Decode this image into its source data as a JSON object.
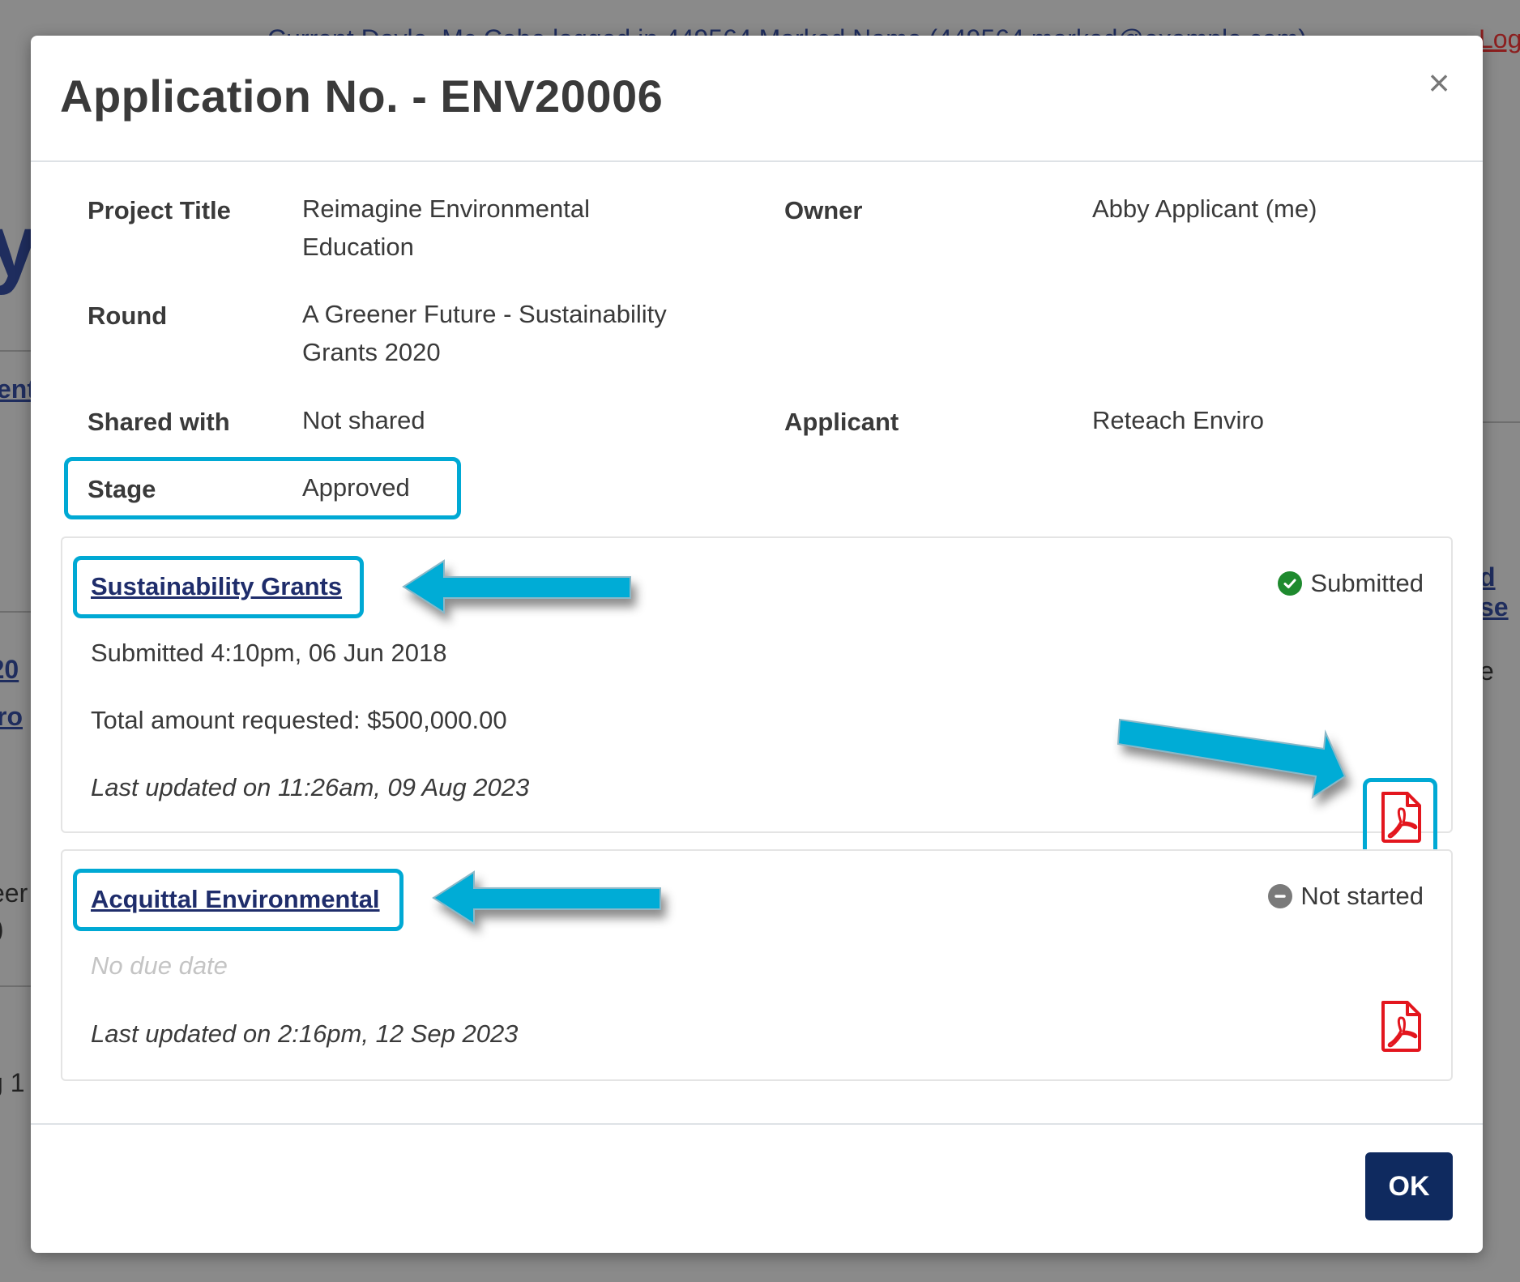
{
  "background": {
    "topbar_text": "Current Doyle, Mc Cabe logged in 449564 Marked Name (449564 marked@example.com)",
    "logout_label": "Log",
    "big_char": "y",
    "link_1": "ent",
    "link_2": "'20",
    "link_3": "ro",
    "text_1": "eer",
    "text_2": ")",
    "text_3": "g 1",
    "link_right": "d se",
    "text_right": "e"
  },
  "modal": {
    "title": "Application No. - ENV20006",
    "close_symbol": "×",
    "fields": {
      "project_title_label": "Project Title",
      "project_title_value_line1": "Reimagine Environmental",
      "project_title_value_line2": "Education",
      "owner_label": "Owner",
      "owner_value": "Abby Applicant (me)",
      "round_label": "Round",
      "round_value_line1": "A Greener Future - Sustainability",
      "round_value_line2": "Grants 2020",
      "shared_with_label": "Shared with",
      "shared_with_value": "Not shared",
      "applicant_label": "Applicant",
      "applicant_value": "Reteach Enviro",
      "stage_label": "Stage",
      "stage_value": "Approved"
    },
    "forms": [
      {
        "name": "Sustainability Grants",
        "status": "Submitted",
        "status_icon": "check-circle-icon",
        "status_color": "#1e8a2e",
        "submitted_text": "Submitted 4:10pm, 06 Jun 2018",
        "amount_text": "Total amount requested: $500,000.00",
        "last_updated": "Last updated on 11:26am, 09 Aug 2023"
      },
      {
        "name": "Acquittal Environmental",
        "status": "Not started",
        "status_icon": "minus-circle-icon",
        "status_color": "#7a7a7a",
        "due_text": "No due date",
        "last_updated": "Last updated on 2:16pm, 12 Sep 2023"
      }
    ],
    "ok_label": "OK"
  },
  "colors": {
    "highlight": "#00a9d4",
    "link": "#1f2d6b",
    "ok_button": "#0f2a5f",
    "pdf_red": "#e3161e"
  }
}
